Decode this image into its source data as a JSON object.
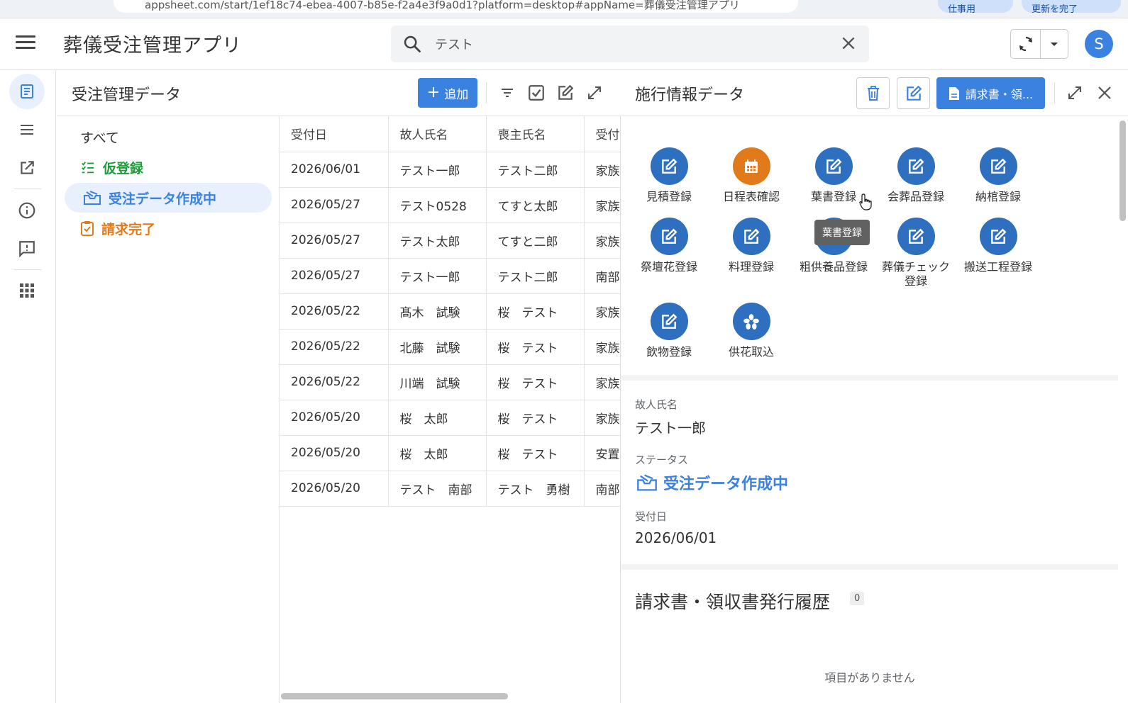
{
  "browser": {
    "url": "appsheet.com/start/1ef18c74-ebea-4007-b85e-f2a4e3f9a0d1?platform=desktop#appName=葬儀受注管理アプリ",
    "pill_left": "仕事用",
    "pill_right": "更新を完了"
  },
  "app": {
    "title": "葬儀受注管理アプリ",
    "search_value": "テスト",
    "user_initial": "S"
  },
  "left_panel": {
    "title": "受注管理データ",
    "add_label": "追加",
    "filters": [
      {
        "label": "すべて",
        "color": "#333333"
      },
      {
        "label": "仮登録",
        "color": "#1e9e3a"
      },
      {
        "label": "受注データ作成中",
        "color": "#3b82e0"
      },
      {
        "label": "請求完了",
        "color": "#e07a1a"
      }
    ],
    "columns": [
      "受付日",
      "故人氏名",
      "喪主氏名",
      "受付"
    ],
    "rows": [
      [
        "2026/06/01",
        "テスト一郎",
        "テスト二郎",
        "家族"
      ],
      [
        "2026/05/27",
        "テスト0528",
        "てすと太郎",
        "家族"
      ],
      [
        "2026/05/27",
        "テスト太郎",
        "てすと二郎",
        "家族"
      ],
      [
        "2026/05/27",
        "テスト一郎",
        "テスト二郎",
        "南部"
      ],
      [
        "2026/05/22",
        "髙木　試験",
        "桜　テスト",
        "家族"
      ],
      [
        "2026/05/22",
        "北藤　試験",
        "桜　テスト",
        "家族"
      ],
      [
        "2026/05/22",
        "川端　試験",
        "桜　テスト",
        "家族"
      ],
      [
        "2026/05/20",
        "桜　太郎",
        "桜　テスト",
        "家族"
      ],
      [
        "2026/05/20",
        "桜　太郎",
        "桜　テスト",
        "安置"
      ],
      [
        "2026/05/20",
        "テスト　南部",
        "テスト　勇樹",
        "南部"
      ]
    ]
  },
  "detail": {
    "title": "施行情報データ",
    "invoice_button": "請求書・領...",
    "actions": [
      {
        "label": "見積登録",
        "icon": "edit-icon",
        "color": "#2e6fbf"
      },
      {
        "label": "日程表確認",
        "icon": "calendar-icon",
        "color": "#e07a1a"
      },
      {
        "label": "葉書登録",
        "icon": "edit-icon",
        "color": "#2e6fbf"
      },
      {
        "label": "会葬品登録",
        "icon": "edit-icon",
        "color": "#2e6fbf"
      },
      {
        "label": "納棺登録",
        "icon": "edit-icon",
        "color": "#2e6fbf"
      },
      {
        "label": "祭壇花登録",
        "icon": "edit-icon",
        "color": "#2e6fbf"
      },
      {
        "label": "料理登録",
        "icon": "edit-icon",
        "color": "#2e6fbf"
      },
      {
        "label": "粗供養品登録",
        "icon": "edit-icon",
        "color": "#2e6fbf"
      },
      {
        "label": "葬儀チェック\n登録",
        "icon": "edit-icon",
        "color": "#2e6fbf"
      },
      {
        "label": "搬送工程登録",
        "icon": "edit-icon",
        "color": "#2e6fbf"
      },
      {
        "label": "飲物登録",
        "icon": "edit-icon",
        "color": "#2e6fbf"
      },
      {
        "label": "供花取込",
        "icon": "flower-icon",
        "color": "#2e6fbf"
      }
    ],
    "tooltip": "葉書登録",
    "fields": {
      "deceased_label": "故人氏名",
      "deceased_value": "テスト一郎",
      "status_label": "ステータス",
      "status_value": "受注データ作成中",
      "date_label": "受付日",
      "date_value": "2026/06/01"
    },
    "history_title": "請求書・領収書発行履歴",
    "history_count": "0",
    "empty_message": "項目がありません"
  }
}
